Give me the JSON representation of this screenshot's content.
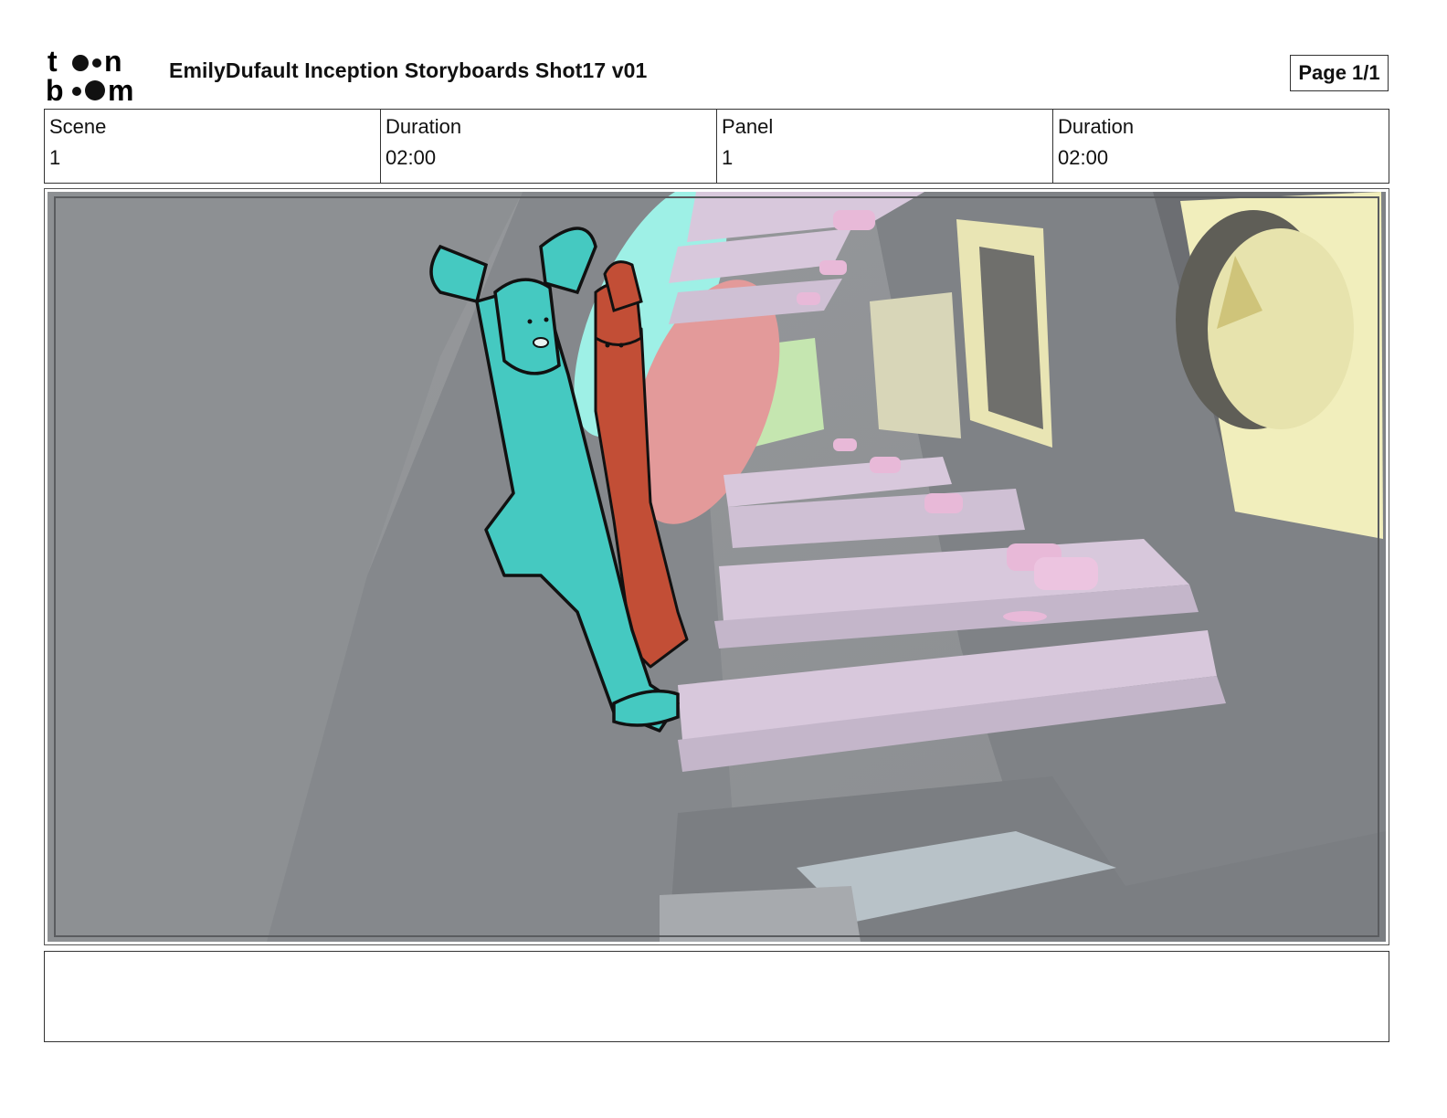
{
  "header": {
    "logo_text": "toonboom",
    "title": "EmilyDufault Inception Storyboards Shot17 v01",
    "page_label": "Page 1/1"
  },
  "info": {
    "scene_label": "Scene",
    "scene_value": "1",
    "scene_duration_label": "Duration",
    "scene_duration_value": "02:00",
    "panel_label": "Panel",
    "panel_value": "1",
    "panel_duration_label": "Duration",
    "panel_duration_value": "02:00"
  },
  "panel": {
    "colors": {
      "background": "#8f9296",
      "teal_character": "#45c9c1",
      "red_character": "#c24e36",
      "pink_props": "#e8b9d8",
      "yellow_panels": "#f1eebc"
    }
  },
  "notes": {
    "action_text": ""
  }
}
